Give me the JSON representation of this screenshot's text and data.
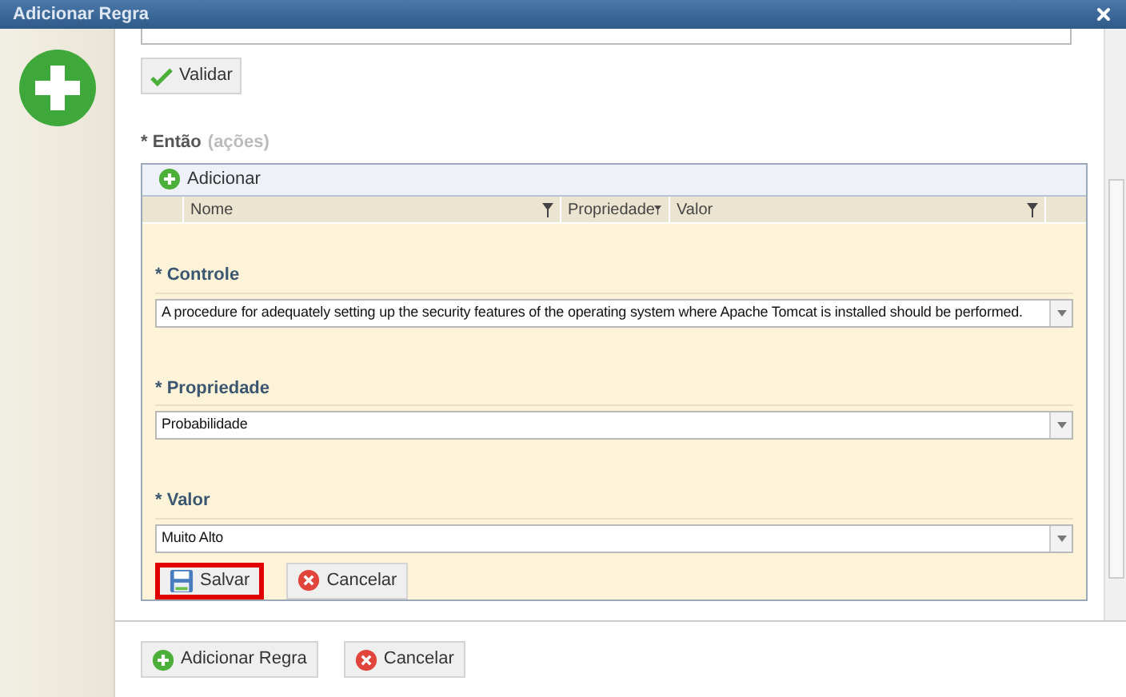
{
  "window": {
    "title": "Adicionar Regra"
  },
  "validate_button": {
    "label": "Validar"
  },
  "then_section": {
    "label": "* Então",
    "hint": "(ações)"
  },
  "actions_toolbar": {
    "add_button": "Adicionar"
  },
  "table": {
    "columns": [
      {
        "label": "Nome"
      },
      {
        "label": "Propriedade"
      },
      {
        "label": "Valor"
      }
    ]
  },
  "form": {
    "fields": [
      {
        "label": "* Controle",
        "value": "A procedure for adequately setting up the security features of the operating system where Apache Tomcat is installed should be performed."
      },
      {
        "label": "* Propriedade",
        "value": "Probabilidade"
      },
      {
        "label": "* Valor",
        "value": "Muito Alto"
      }
    ],
    "buttons": [
      {
        "kind": "save",
        "label": "Salvar",
        "highlighted": true
      },
      {
        "kind": "cancel",
        "label": "Cancelar",
        "highlighted": false
      }
    ]
  },
  "footer_buttons": [
    {
      "kind": "add",
      "label": "Adicionar Regra"
    },
    {
      "kind": "cancel",
      "label": "Cancelar"
    }
  ]
}
